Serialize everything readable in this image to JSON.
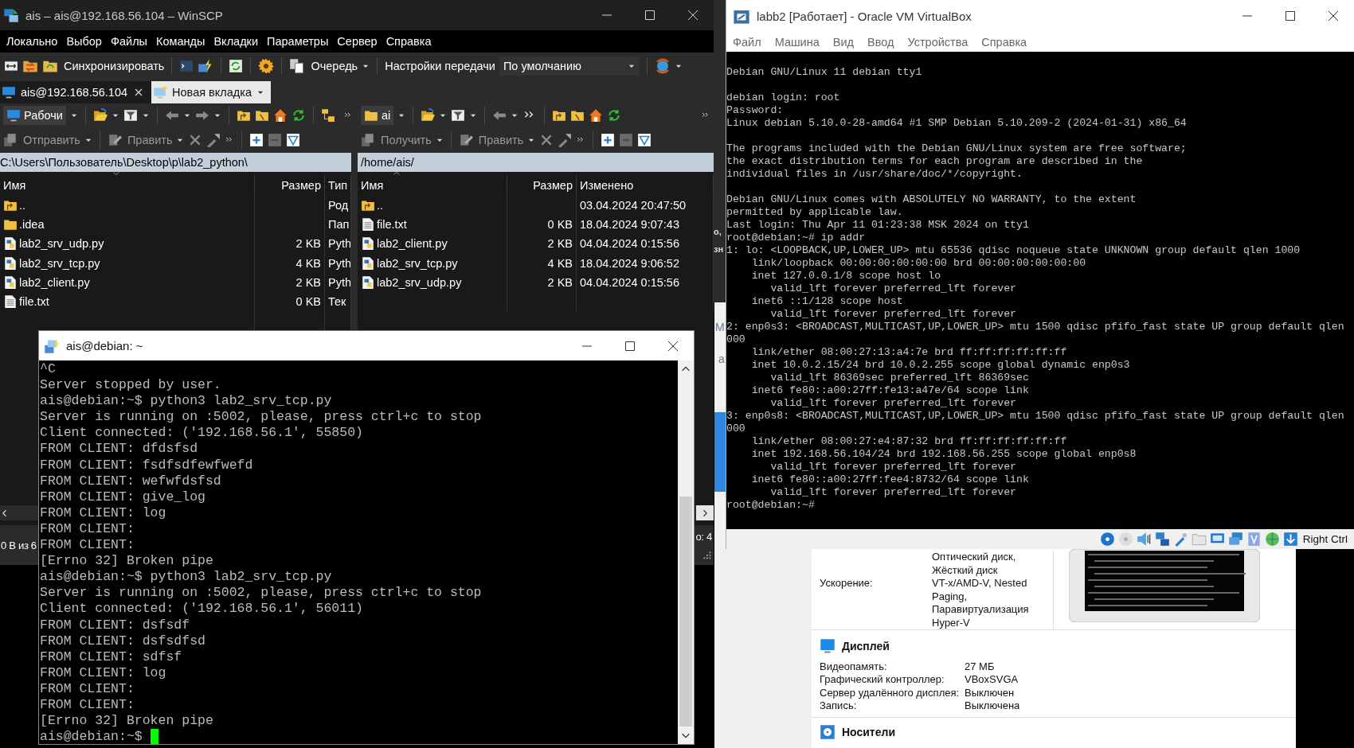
{
  "winscp": {
    "title": "ais – ais@192.168.56.104 – WinSCP",
    "menu": [
      "Локально",
      "Выбор",
      "Файлы",
      "Команды",
      "Вкладки",
      "Параметры",
      "Сервер",
      "Справка"
    ],
    "toolbar": {
      "synchronize": "Синхронизировать",
      "queue": "Очередь",
      "transfer_label": "Настройки передачи",
      "transfer_value": "По умолчанию"
    },
    "tabs": [
      {
        "label": "ais@192.168.56.104",
        "selected": true
      },
      {
        "label": "Новая вкладка",
        "selected": false
      }
    ],
    "local": {
      "location": "Рабочи",
      "transfer": "Отправить",
      "edit": "Править",
      "path": "C:\\Users\\Пользователь\\Desktop\\p\\lab2_python\\",
      "columns": [
        "Имя",
        "Размер",
        "Тип"
      ],
      "rows": [
        {
          "kind": "parent",
          "name": "..",
          "type": "Род"
        },
        {
          "kind": "folder",
          "name": ".idea",
          "type": "Пап"
        },
        {
          "kind": "python",
          "name": "lab2_srv_udp.py",
          "size": "2 KB",
          "type": "Pyth"
        },
        {
          "kind": "python",
          "name": "lab2_srv_tcp.py",
          "size": "4 KB",
          "type": "Pyth"
        },
        {
          "kind": "python",
          "name": "lab2_client.py",
          "size": "2 KB",
          "type": "Pyth"
        },
        {
          "kind": "text",
          "name": "file.txt",
          "size": "0 KB",
          "type": "Тек"
        }
      ]
    },
    "remote": {
      "location": "ai",
      "transfer": "Получить",
      "edit": "Править",
      "path": "/home/ais/",
      "columns": [
        "Имя",
        "Размер",
        "Изменено"
      ],
      "rows": [
        {
          "kind": "parent",
          "name": "..",
          "modified": "03.04.2024 20:47:50"
        },
        {
          "kind": "text",
          "name": "file.txt",
          "size": "0 KB",
          "modified": "18.04.2024 9:07:43"
        },
        {
          "kind": "python",
          "name": "lab2_client.py",
          "size": "2 KB",
          "modified": "04.04.2024 0:15:56"
        },
        {
          "kind": "python",
          "name": "lab2_srv_tcp.py",
          "size": "4 KB",
          "modified": "18.04.2024 9:06:52"
        },
        {
          "kind": "python",
          "name": "lab2_srv_udp.py",
          "size": "2 KB",
          "modified": "04.04.2024 0:15:56"
        }
      ]
    },
    "status": {
      "left": "0 B из 6",
      "right": "о: 4"
    }
  },
  "background_fragments": {
    "dark": [
      "о,",
      "зн"
    ],
    "light": [
      "М",
      "а"
    ]
  },
  "vbox_manager": {
    "system_rows": [
      {
        "values": [
          "Оптический диск,",
          "Жёсткий диск"
        ]
      },
      {
        "label": "Ускорение:",
        "values": [
          "VT-x/AMD-V, Nested",
          "Paging,",
          "Паравиртуализация",
          "Hyper-V"
        ]
      }
    ],
    "display": {
      "title": "Дисплей",
      "rows": [
        {
          "label": "Видеопамять:",
          "value": "27 МБ"
        },
        {
          "label": "Графический контроллер:",
          "value": "VBoxSVGA"
        },
        {
          "label": "Сервер удалённого дисплея:",
          "value": "Выключен"
        },
        {
          "label": "Запись:",
          "value": "Выключена"
        }
      ]
    },
    "storage": {
      "title": "Носители"
    }
  },
  "vbox_vm": {
    "title": "labb2 [Работает] - Oracle VM VirtualBox",
    "menu": [
      "Файл",
      "Машина",
      "Вид",
      "Ввод",
      "Устройства",
      "Справка"
    ],
    "console_blocks": [
      [
        "Debian GNU/Linux 11 debian tty1"
      ],
      [
        "debian login: root",
        "Password:",
        "Linux debian 5.10.0-28-amd64 #1 SMP Debian 5.10.209-2 (2024-01-31) x86_64"
      ],
      [
        "The programs included with the Debian GNU/Linux system are free software;",
        "the exact distribution terms for each program are described in the",
        "individual files in /usr/share/doc/*/copyright."
      ],
      [
        "Debian GNU/Linux comes with ABSOLUTELY NO WARRANTY, to the extent",
        "permitted by applicable law.",
        "Last login: Thu Apr 11 01:23:38 MSK 2024 on tty1",
        "root@debian:~# ip addr",
        "1: lo: <LOOPBACK,UP,LOWER_UP> mtu 65536 qdisc noqueue state UNKNOWN group default qlen 1000",
        "    link/loopback 00:00:00:00:00:00 brd 00:00:00:00:00:00",
        "    inet 127.0.0.1/8 scope host lo",
        "       valid_lft forever preferred_lft forever",
        "    inet6 ::1/128 scope host",
        "       valid_lft forever preferred_lft forever",
        "2: enp0s3: <BROADCAST,MULTICAST,UP,LOWER_UP> mtu 1500 qdisc pfifo_fast state UP group default qlen",
        "000",
        "    link/ether 08:00:27:13:a4:7e brd ff:ff:ff:ff:ff:ff",
        "    inet 10.0.2.15/24 brd 10.0.2.255 scope global dynamic enp0s3",
        "       valid_lft 86369sec preferred_lft 86369sec",
        "    inet6 fe80::a00:27ff:fe13:a47e/64 scope link",
        "       valid_lft forever preferred_lft forever",
        "3: enp0s8: <BROADCAST,MULTICAST,UP,LOWER_UP> mtu 1500 qdisc pfifo_fast state UP group default qlen",
        "000",
        "    link/ether 08:00:27:e4:87:32 brd ff:ff:ff:ff:ff:ff",
        "    inet 192.168.56.104/24 brd 192.168.56.255 scope global enp0s8",
        "       valid_lft forever preferred_lft forever",
        "    inet6 fe80::a00:27ff:fee4:8732/64 scope link",
        "       valid_lft forever preferred_lft forever",
        "root@debian:~#"
      ]
    ],
    "host_key": "Right Ctrl"
  },
  "putty": {
    "title": "ais@debian: ~",
    "lines": [
      "^C",
      "Server stopped by user.",
      "ais@debian:~$ python3 lab2_srv_tcp.py",
      "Server is running on :5002, please, press ctrl+c to stop",
      "Client connected: ('192.168.56.1', 55850)",
      "FROM CLIENT: dfdsfsd",
      "FROM CLIENT: fsdfsdfewfwefd",
      "FROM CLIENT: wefwfdsfsd",
      "FROM CLIENT: give_log",
      "FROM CLIENT: log",
      "FROM CLIENT:",
      "FROM CLIENT:",
      "[Errno 32] Broken pipe",
      "ais@debian:~$ python3 lab2_srv_tcp.py",
      "Server is running on :5002, please, press ctrl+c to stop",
      "Client connected: ('192.168.56.1', 56011)",
      "FROM CLIENT: dsfsdf",
      "FROM CLIENT: dsfsdfsd",
      "FROM CLIENT: sdfsf",
      "FROM CLIENT: log",
      "FROM CLIENT:",
      "FROM CLIENT:",
      "[Errno 32] Broken pipe"
    ],
    "prompt": "ais@debian:~$"
  }
}
